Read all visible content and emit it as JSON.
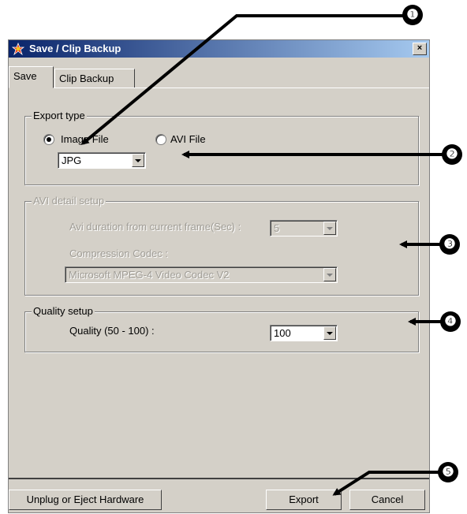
{
  "window": {
    "title": "Save / Clip Backup",
    "close_label": "×",
    "icon": "app-icon"
  },
  "tabs": [
    {
      "label": "Save",
      "active": true
    },
    {
      "label": "Clip Backup",
      "active": false
    }
  ],
  "export_type": {
    "group_label": "Export type",
    "options": [
      {
        "label": "Image File",
        "selected": true
      },
      {
        "label": "AVI File",
        "selected": false
      }
    ],
    "image_format": "JPG"
  },
  "avi_detail": {
    "group_label": "AVI detail setup",
    "duration_label": "Avi duration from current frame(Sec) :",
    "duration_value": "5",
    "codec_label": "Compression Codec :",
    "codec_value": "Microsoft MPEG-4 Video Codec V2"
  },
  "quality_setup": {
    "group_label": "Quality setup",
    "quality_label": "Quality (50 - 100) :",
    "quality_value": "100"
  },
  "buttons": {
    "unplug": "Unplug or Eject Hardware",
    "export": "Export",
    "cancel": "Cancel"
  },
  "callouts": [
    "❶",
    "❷",
    "❸",
    "❹",
    "❺"
  ]
}
